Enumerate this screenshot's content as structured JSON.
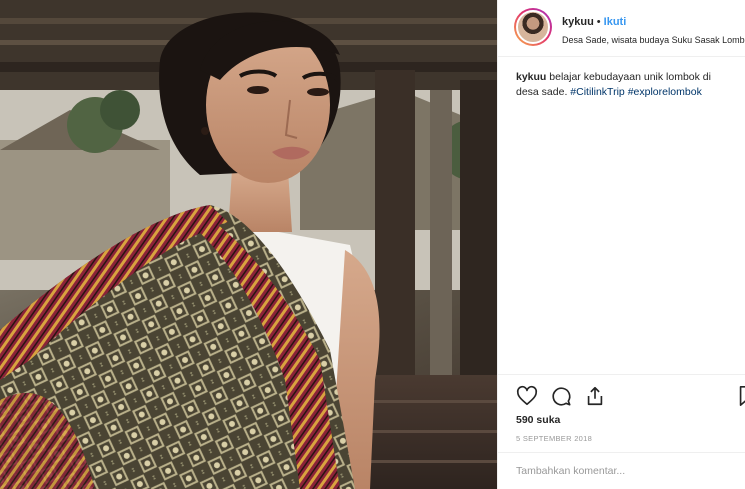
{
  "post": {
    "photo_alt": "kykuu",
    "username": "kykuu",
    "separator": "•",
    "follow_label": "Ikuti",
    "location": "Desa Sade, wisata budaya Suku Sasak Lombok",
    "caption": {
      "user": "kykuu",
      "text": "belajar kebudayaan unik lombok di desa sade.",
      "hashtags": [
        "#CitilinkTrip",
        "#explorelombok"
      ]
    },
    "likes": "590 suka",
    "date": "5 SEPTEMBER 2018",
    "comment_placeholder": "Tambahkan komentar..."
  },
  "icons": {
    "like": "heart-icon",
    "comment": "comment-bubble-icon",
    "share": "share-icon",
    "save": "bookmark-icon"
  },
  "colors": {
    "link": "#3897f0",
    "hashtag": "#003569",
    "text": "#262626",
    "muted": "#999999",
    "divider": "#efefef"
  }
}
